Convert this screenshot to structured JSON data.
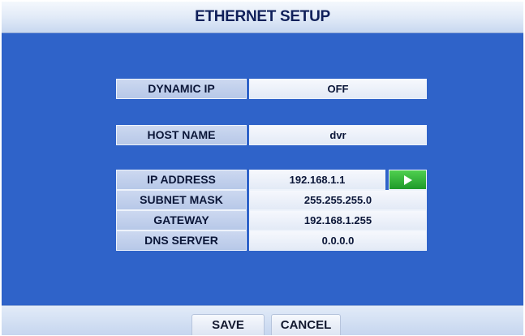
{
  "window": {
    "title": "ETHERNET SETUP"
  },
  "fields": {
    "dynamic_ip": {
      "label": "DYNAMIC IP",
      "value": "OFF"
    },
    "host_name": {
      "label": "HOST NAME",
      "value": "dvr"
    },
    "ip_address": {
      "label": "IP ADDRESS",
      "value": "192.168.1.1"
    },
    "subnet_mask": {
      "label": "SUBNET MASK",
      "value": "255.255.255.0"
    },
    "gateway": {
      "label": "GATEWAY",
      "value": "192.168.1.255"
    },
    "dns_server": {
      "label": "DNS SERVER",
      "value": "0.0.0.0"
    }
  },
  "icons": {
    "ip_arrow": "play-arrow-icon"
  },
  "buttons": {
    "save": "SAVE",
    "cancel": "CANCEL"
  },
  "colors": {
    "background": "#2f63c9",
    "arrow_button": "#2fb33a"
  }
}
